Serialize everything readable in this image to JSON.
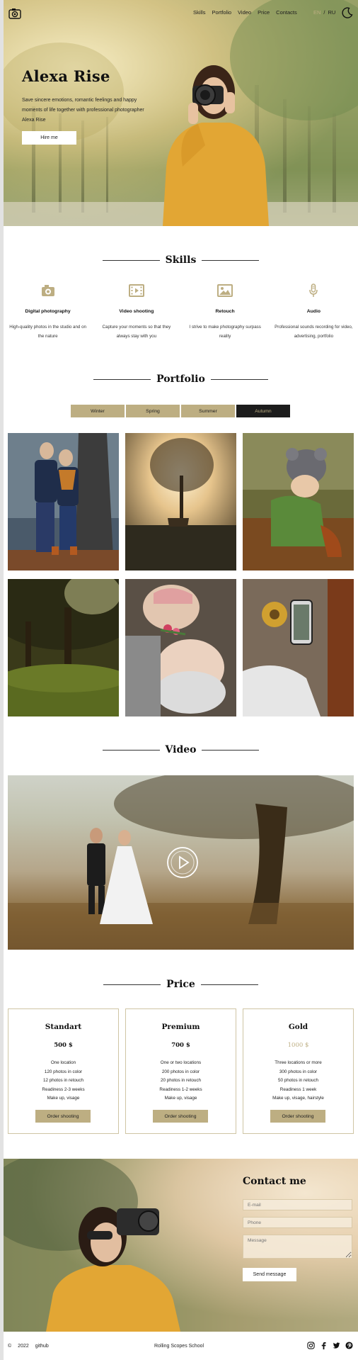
{
  "header": {
    "nav": [
      "Skills",
      "Portfolio",
      "Video",
      "Price",
      "Contacts"
    ],
    "lang_en": "EN",
    "lang_sep": "/",
    "lang_ru": "RU"
  },
  "hero": {
    "title": "Alexa Rise",
    "text": "Save sincere emotions, romantic feelings and happy moments of life together with professional photographer Alexa Rise",
    "button": "Hire me"
  },
  "skills": {
    "title": "Skills",
    "items": [
      {
        "title": "Digital photography",
        "text": "High-quality photos in the studio and on the nature",
        "icon": "camera-icon"
      },
      {
        "title": "Video shooting",
        "text": "Capture your moments so that they always stay with you",
        "icon": "video-icon"
      },
      {
        "title": "Retouch",
        "text": "I strive to make photography surpass reality",
        "icon": "image-icon"
      },
      {
        "title": "Audio",
        "text": "Professional sounds recording for video, advertising, portfolio",
        "icon": "microphone-icon"
      }
    ]
  },
  "portfolio": {
    "title": "Portfolio",
    "seasons": [
      "Winter",
      "Spring",
      "Summer",
      "Autumn"
    ],
    "active_season": "Autumn"
  },
  "video": {
    "title": "Video"
  },
  "price": {
    "title": "Price",
    "plans": [
      {
        "name": "Standart",
        "amount": "500 $",
        "features": [
          "One location",
          "120 photos in color",
          "12 photos in retouch",
          "Readiness 2-3 weeks",
          "Make up, visage"
        ],
        "button": "Order shooting"
      },
      {
        "name": "Premium",
        "amount": "700 $",
        "features": [
          "One or two locations",
          "200 photos in color",
          "20 photos in retouch",
          "Readiness 1-2 weeks",
          "Make up, visage"
        ],
        "button": "Order shooting"
      },
      {
        "name": "Gold",
        "amount": "1000 $",
        "features": [
          "Three locations or more",
          "300 photos in color",
          "50 photos in retouch",
          "Readiness 1 week",
          "Make up, visage, hairstyle"
        ],
        "button": "Order shooting"
      }
    ]
  },
  "contact": {
    "title": "Contact me",
    "email_placeholder": "E-mail",
    "phone_placeholder": "Phone",
    "message_placeholder": "Message",
    "button": "Send message"
  },
  "footer": {
    "copyright": "©",
    "year": "2022",
    "github": "github",
    "school": "Rolling Scopes School"
  },
  "colors": {
    "accent": "#bdae82",
    "dark": "#1c1c1c"
  }
}
